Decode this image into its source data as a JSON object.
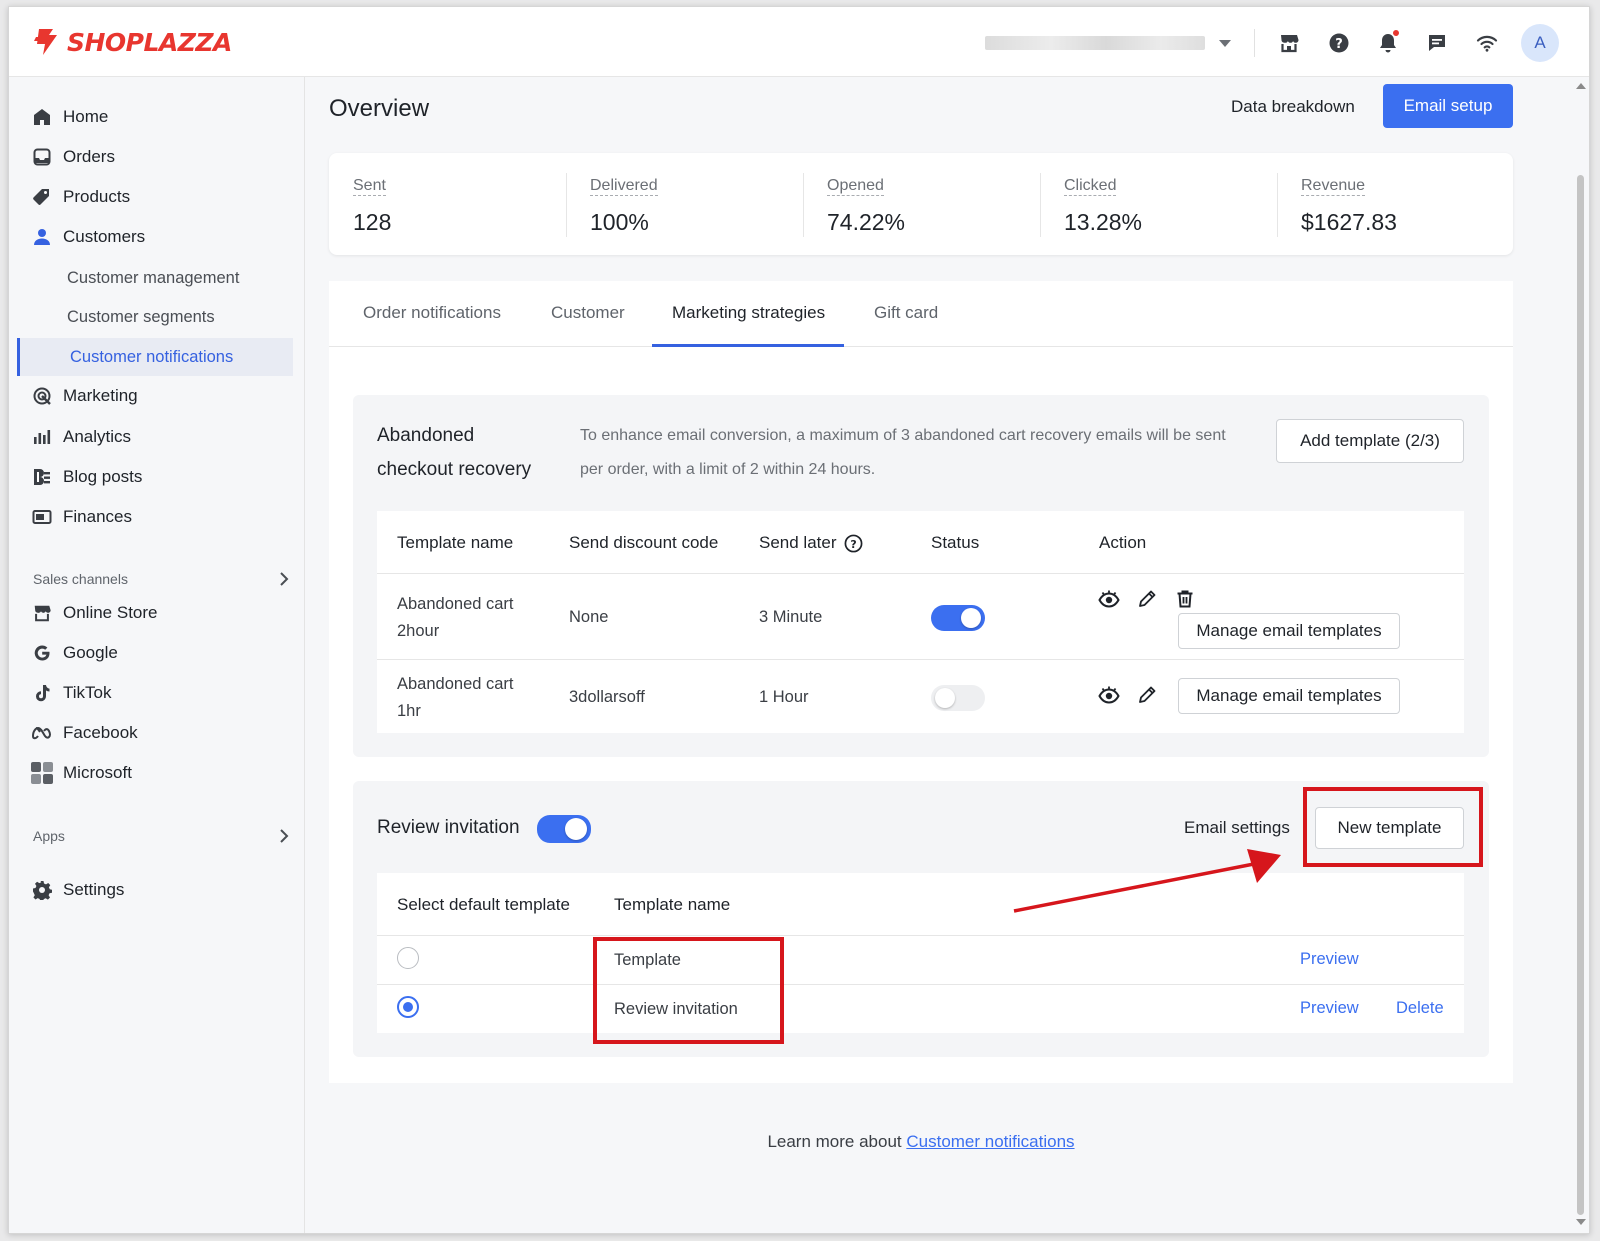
{
  "brand": {
    "name": "SHOPLAZZA",
    "color": "#e8362f"
  },
  "accent": "#3b6ff0",
  "header_icons": [
    "store-icon",
    "help-icon",
    "bell-icon",
    "chat-icon",
    "wifi-icon"
  ],
  "user": {
    "avatar_initial": "A"
  },
  "sidebar": {
    "items": [
      {
        "label": "Home",
        "icon": "home-icon"
      },
      {
        "label": "Orders",
        "icon": "orders-icon"
      },
      {
        "label": "Products",
        "icon": "tag-icon"
      },
      {
        "label": "Customers",
        "icon": "person-icon"
      }
    ],
    "customer_sub": [
      "Customer management",
      "Customer segments",
      "Customer notifications"
    ],
    "items2": [
      {
        "label": "Marketing",
        "icon": "marketing-icon"
      },
      {
        "label": "Analytics",
        "icon": "analytics-icon"
      },
      {
        "label": "Blog posts",
        "icon": "blog-icon"
      },
      {
        "label": "Finances",
        "icon": "finances-icon"
      }
    ],
    "sales_channels_label": "Sales channels",
    "channels": [
      {
        "label": "Online Store",
        "icon": "store-icon"
      },
      {
        "label": "Google",
        "icon": "google-icon"
      },
      {
        "label": "TikTok",
        "icon": "tiktok-icon"
      },
      {
        "label": "Facebook",
        "icon": "meta-icon"
      },
      {
        "label": "Microsoft",
        "icon": "microsoft-icon"
      }
    ],
    "apps_label": "Apps",
    "settings_label": "Settings"
  },
  "page": {
    "title": "Overview",
    "data_breakdown": "Data breakdown",
    "email_setup": "Email setup"
  },
  "stats": [
    {
      "label": "Sent",
      "value": "128"
    },
    {
      "label": "Delivered",
      "value": "100%"
    },
    {
      "label": "Opened",
      "value": "74.22%"
    },
    {
      "label": "Clicked",
      "value": "13.28%"
    },
    {
      "label": "Revenue",
      "value": "$1627.83"
    }
  ],
  "tabs": [
    "Order notifications",
    "Customer",
    "Marketing strategies",
    "Gift card"
  ],
  "active_tab": "Marketing strategies",
  "abandoned": {
    "title_line1": "Abandoned",
    "title_line2": "checkout recovery",
    "desc_line1": "To enhance email conversion, a maximum of 3 abandoned cart recovery emails will be sent",
    "desc_line2": "per order, with a limit of 2 within 24 hours.",
    "add_button": "Add template (2/3)",
    "columns": [
      "Template name",
      "Send discount code",
      "Send later",
      "Status",
      "Action"
    ],
    "rows": [
      {
        "name_line1": "Abandoned cart",
        "name_line2": "2hour",
        "discount": "None",
        "send_later": "3 Minute",
        "status_on": true,
        "manage": "Manage email templates"
      },
      {
        "name_line1": "Abandoned cart",
        "name_line2": "1hr",
        "discount": "3dollarsoff",
        "send_later": "1 Hour",
        "status_on": false,
        "manage": "Manage email templates"
      }
    ]
  },
  "review": {
    "title": "Review invitation",
    "enabled": true,
    "email_settings": "Email settings",
    "new_template": "New template",
    "columns": [
      "Select default template",
      "Template name"
    ],
    "rows": [
      {
        "name": "Template",
        "selected": false,
        "preview": "Preview",
        "delete": ""
      },
      {
        "name": "Review invitation",
        "selected": true,
        "preview": "Preview",
        "delete": "Delete"
      }
    ]
  },
  "footer": {
    "prefix": "Learn more about ",
    "link": "Customer notifications"
  },
  "annotation_color": "#d6161c"
}
